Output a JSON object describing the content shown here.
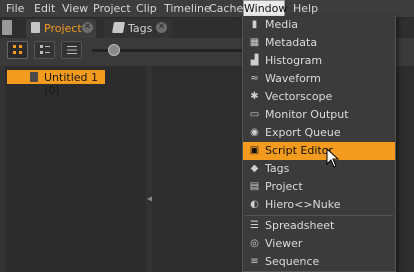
{
  "menubar": {
    "items": [
      {
        "label": "File"
      },
      {
        "label": "Edit"
      },
      {
        "label": "View"
      },
      {
        "label": "Project"
      },
      {
        "label": "Clip"
      },
      {
        "label": "Timeline"
      },
      {
        "label": "Cache"
      },
      {
        "label": "Window"
      },
      {
        "label": "Help"
      }
    ]
  },
  "tabs": [
    {
      "label": "Project",
      "icon": "project-icon",
      "active": true
    },
    {
      "label": "Tags",
      "icon": "tags-icon",
      "active": false
    }
  ],
  "toolbar": {
    "view_modes": [
      "grid-view",
      "details-view",
      "list-view"
    ],
    "selected_view": "grid-view"
  },
  "project_tree": {
    "items": [
      {
        "label": "Untitled 1 (0)",
        "selected": true
      }
    ]
  },
  "window_menu": {
    "groups": [
      [
        {
          "label": "Media",
          "icon": "media-icon"
        },
        {
          "label": "Metadata",
          "icon": "metadata-icon"
        },
        {
          "label": "Histogram",
          "icon": "histogram-icon"
        },
        {
          "label": "Waveform",
          "icon": "waveform-icon"
        },
        {
          "label": "Vectorscope",
          "icon": "vectorscope-icon"
        },
        {
          "label": "Monitor Output",
          "icon": "monitor-icon"
        },
        {
          "label": "Export Queue",
          "icon": "export-queue-icon"
        },
        {
          "label": "Script Editor",
          "icon": "script-editor-icon",
          "highlighted": true
        },
        {
          "label": "Tags",
          "icon": "tags-icon"
        },
        {
          "label": "Project",
          "icon": "project-icon"
        },
        {
          "label": "Hiero<>Nuke",
          "icon": "hiero-nuke-icon"
        }
      ],
      [
        {
          "label": "Spreadsheet",
          "icon": "spreadsheet-icon"
        },
        {
          "label": "Viewer",
          "icon": "viewer-icon"
        },
        {
          "label": "Sequence",
          "icon": "sequence-icon"
        }
      ]
    ]
  },
  "colors": {
    "accent": "#f39b1f",
    "menu_bg": "#3b3b3b",
    "panel_bg": "#2c2c2c"
  }
}
